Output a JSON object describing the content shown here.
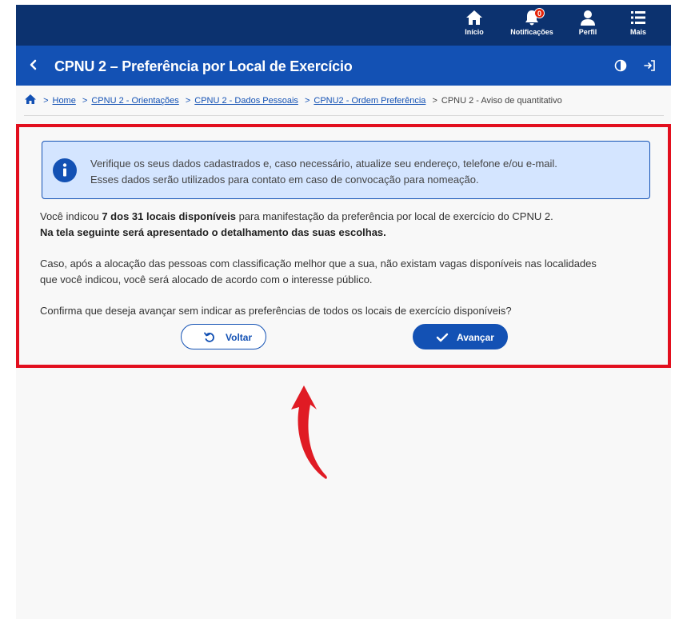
{
  "topbar": {
    "items": [
      {
        "label": "Início",
        "icon": "home-icon"
      },
      {
        "label": "Notificações",
        "icon": "bell-icon",
        "badge": "0"
      },
      {
        "label": "Perfil",
        "icon": "user-icon"
      },
      {
        "label": "Mais",
        "icon": "menu-list-icon"
      }
    ]
  },
  "titlebar": {
    "title": "CPNU 2 – Preferência por Local de Exercício"
  },
  "breadcrumb": {
    "sep": ">",
    "links": [
      "Home",
      "CPNU 2 - Orientações",
      "CPNU 2 - Dados Pessoais",
      "CPNU2 - Ordem Preferência"
    ],
    "current": "CPNU 2 - Aviso de quantitativo"
  },
  "alert": {
    "line1": "Verifique os seus dados cadastrados e, caso necessário, atualize seu endereço, telefone e/ou e-mail.",
    "line2": "Esses dados serão utilizados para contato em caso de convocação para nomeação."
  },
  "content": {
    "p1_pre": "Você indicou ",
    "p1_bold": "7 dos 31 locais disponíveis",
    "p1_post": " para manifestação da preferência por local de exercício do CPNU 2.",
    "p1_line2": "Na tela seguinte será apresentado o detalhamento das suas escolhas.",
    "p2_line1": "Caso, após a alocação das pessoas com classificação melhor que a sua, não existam vagas disponíveis nas localidades",
    "p2_line2": "que você indicou, você será alocado de acordo com o interesse público.",
    "p3": "Confirma que deseja avançar sem indicar as preferências de todos os locais de exercício disponíveis?"
  },
  "buttons": {
    "back": "Voltar",
    "next": "Avançar"
  },
  "colors": {
    "topbar": "#0c326f",
    "titlebar": "#1351b4",
    "highlight": "#e20f1e",
    "alert_bg": "#d4e5ff"
  }
}
